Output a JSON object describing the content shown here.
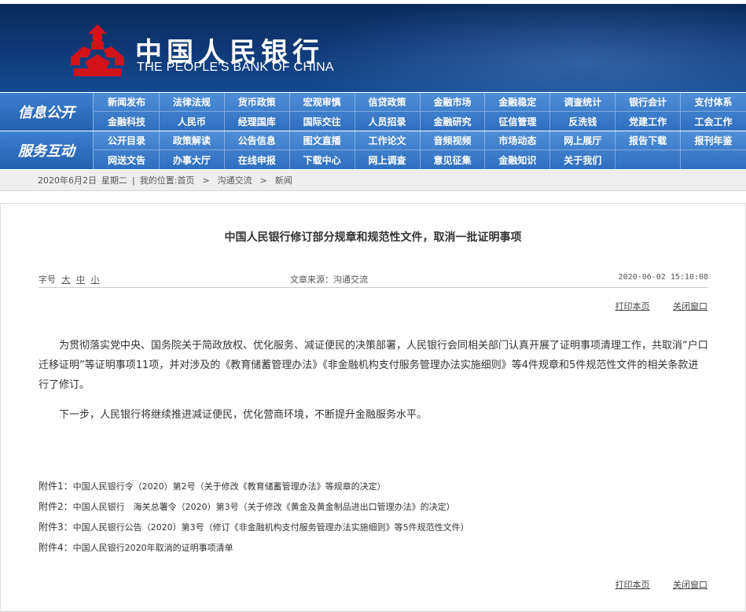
{
  "header": {
    "logo_cn": "中国人民银行",
    "logo_en": "THE PEOPLE'S BANK OF CHINA"
  },
  "nav": {
    "info_label": "信息公开",
    "info_items": [
      "新闻发布",
      "法律法规",
      "货币政策",
      "宏观审慎",
      "信贷政策",
      "金融市场",
      "金融稳定",
      "调查统计",
      "银行会计",
      "支付体系",
      "金融科技",
      "人民币",
      "经理国库",
      "国际交往",
      "人员招录",
      "金融研究",
      "征信管理",
      "反洗钱",
      "党建工作",
      "工会工作"
    ],
    "service_label": "服务互动",
    "service_items": [
      "公开目录",
      "政策解读",
      "公告信息",
      "图文直播",
      "工作论文",
      "音频视频",
      "市场动态",
      "网上展厅",
      "报告下载",
      "报刊年鉴",
      "网送文告",
      "办事大厅",
      "在线申报",
      "下载中心",
      "网上调查",
      "意见征集",
      "金融知识",
      "关于我们",
      "",
      ""
    ]
  },
  "breadcrumb": {
    "date": "2020年6月2日",
    "weekday": "星期二",
    "sep": "|",
    "location_label": "我的位置:",
    "home": "首页",
    "arrow1": ">",
    "section": "沟通交流",
    "arrow2": ">",
    "page": "新闻"
  },
  "article": {
    "title": "中国人民银行修订部分规章和规范性文件，取消一批证明事项",
    "font_size_label": "字号",
    "font_large": "大",
    "font_medium": "中",
    "font_small": "小",
    "source": "文章来源：沟通交流",
    "publish_time": "2020-06-02 15:10:08",
    "print_label": "打印本页",
    "close_label": "关闭窗口",
    "paragraphs": [
      "为贯彻落实党中央、国务院关于简政放权、优化服务、减证便民的决策部署，人民银行会同相关部门认真开展了证明事项清理工作，共取消“户口迁移证明”等证明事项11项，并对涉及的《教育储蓄管理办法》《非金融机构支付服务管理办法实施细则》等4件规章和5件规范性文件的相关条款进行了修订。",
      "下一步，人民银行将继续推进减证便民，优化营商环境，不断提升金融服务水平。"
    ],
    "attachments": [
      {
        "label": "附件1：",
        "text": "中国人民银行令（2020）第2号（关于修改《教育储蓄管理办法》等规章的决定）"
      },
      {
        "label": "附件2：",
        "text": "中国人民银行　海关总署令（2020）第3号（关于修改《黄金及黄金制品进出口管理办法》的决定）"
      },
      {
        "label": "附件3：",
        "text": "中国人民银行公告（2020）第3号（修订《非金融机构支付服务管理办法实施细则》等5件规范性文件）"
      },
      {
        "label": "附件4：",
        "text": "中国人民银行2020年取消的证明事项清单"
      }
    ]
  },
  "colors": {
    "banner": "#0f3a78",
    "nav": "#2f6fbf",
    "logo_red": "#d3121a"
  }
}
